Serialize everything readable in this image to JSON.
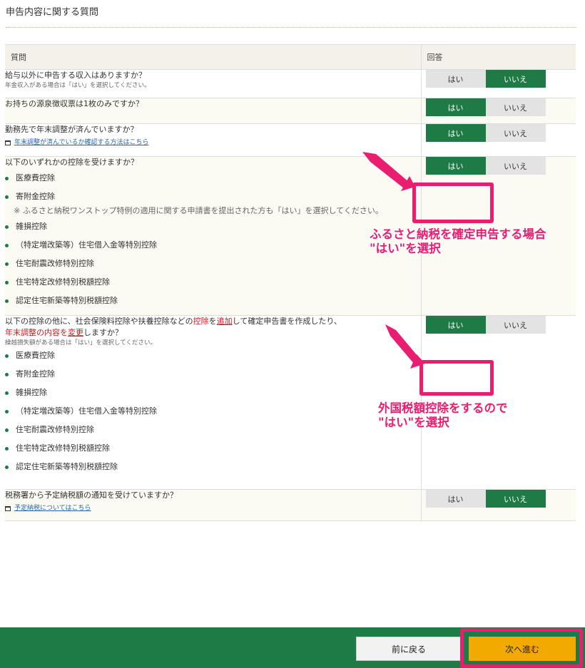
{
  "section_title": "申告内容に関する質問",
  "table": {
    "header_question": "質問",
    "header_answer": "回答"
  },
  "yes_label": "はい",
  "no_label": "いいえ",
  "questions": [
    {
      "text": "給与以外に申告する収入はありますか？",
      "note": "年金収入がある場合は「はい」を選択してください。",
      "answer": "no"
    },
    {
      "text": "お持ちの源泉徴収票は1枚のみですか？",
      "answer": "yes"
    },
    {
      "text": "勤務先で年末調整が済んでいますか？",
      "link": "年末調整が済んでいるか確認する方法はこちら",
      "answer": "yes"
    },
    {
      "text": "以下のいずれかの控除を受けますか？",
      "items": [
        "医療費控除",
        "寄附金控除",
        "雑損控除",
        "（特定増改築等）住宅借入金等特別控除",
        "住宅耐震改修特別控除",
        "住宅特定改修特別税額控除",
        "認定住宅新築等特別税額控除"
      ],
      "item_note": "※ ふるさと納税ワンストップ特例の適用に関する申請書を提出された方も「はい」を選択してください。",
      "answer": "yes"
    },
    {
      "text_a": "以下の控除の他に、社会保険料控除や扶養控除などの",
      "text_b": "控除",
      "text_c": "を",
      "text_d": "追加",
      "text_e": "して確定申告書を作成したり、",
      "text_f": "年末調整の内容を",
      "text_g": "変更",
      "text_h": "しますか？",
      "note": "繰越損失額がある場合は「はい」を選択してください。",
      "items": [
        "医療費控除",
        "寄附金控除",
        "雑損控除",
        "（特定増改築等）住宅借入金等特別控除",
        "住宅耐震改修特別控除",
        "住宅特定改修特別税額控除",
        "認定住宅新築等特別税額控除"
      ],
      "answer": "yes"
    },
    {
      "text": "税務署から予定納税額の通知を受けていますか？",
      "link": "予定納税についてはこちら",
      "answer": "no"
    }
  ],
  "buttons": {
    "back": "前に戻る",
    "next": "次へ進む"
  },
  "annotations": {
    "callout1_line1": "ふるさと納税を確定申告する場合",
    "callout1_line2": "\"はい\"を選択",
    "callout2_line1": "外国税額控除をするので",
    "callout2_line2": "\"はい\"を選択",
    "highlight_color": "#ea1e71"
  },
  "colors": {
    "green": "#1e7b46",
    "orange": "#f2a900",
    "red_text": "#c8191b"
  }
}
